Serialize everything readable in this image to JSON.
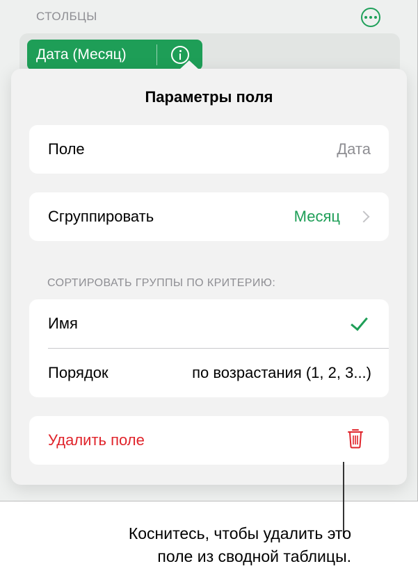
{
  "columns": {
    "section_label": "СТОЛБЦЫ",
    "field_pill_label": "Дата (Месяц)"
  },
  "popover": {
    "title": "Параметры поля",
    "field_row": {
      "label": "Поле",
      "value": "Дата"
    },
    "group_row": {
      "label": "Сгруппировать",
      "value": "Месяц"
    },
    "sort_header": "СОРТИРОВАТЬ ГРУППЫ ПО КРИТЕРИЮ:",
    "sort_name_row": {
      "label": "Имя"
    },
    "sort_order_row": {
      "label": "Порядок",
      "value": "по возрастания (1, 2, 3...)"
    },
    "delete_row": {
      "label": "Удалить поле"
    }
  },
  "callout": {
    "line1": "Коснитесь, чтобы удалить это",
    "line2": "поле из сводной таблицы."
  },
  "colors": {
    "accent_green": "#1e9e57",
    "destructive_red": "#e0242b",
    "secondary_gray": "#8e8e93"
  },
  "icons": [
    "more-icon",
    "info-icon",
    "chevron-right-icon",
    "checkmark-icon",
    "trash-icon"
  ]
}
